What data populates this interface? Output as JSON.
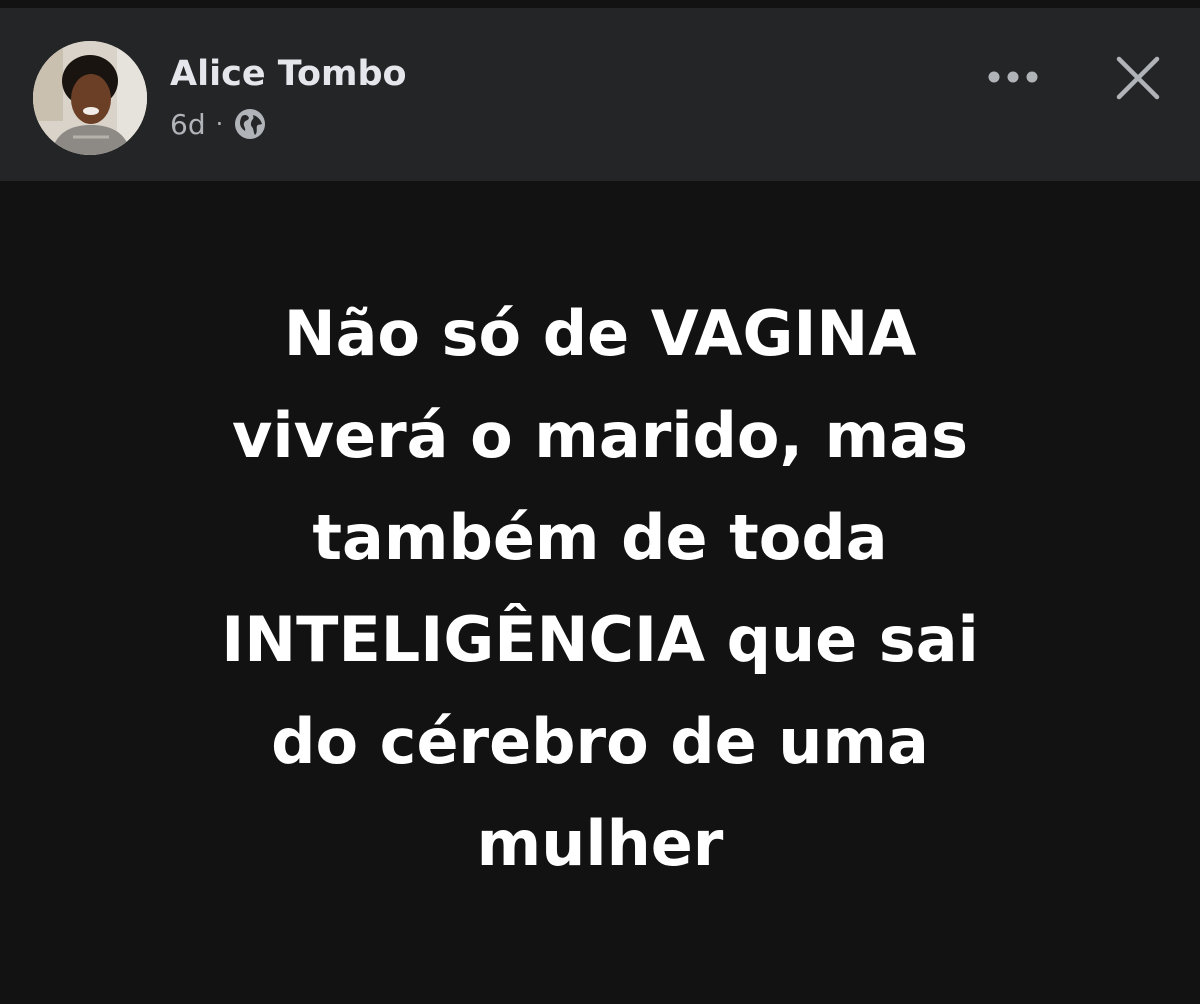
{
  "post": {
    "author": "Alice Tombo",
    "time": "6d",
    "separator": "·",
    "privacy_icon": "globe-icon",
    "more_icon": "more-horizontal-icon",
    "close_icon": "close-icon",
    "text": "Não só de VAGINA\nviverá o marido, mas\ntambém de toda\nINTELIGÊNCIA que sai\ndo cérebro de uma\nmulher"
  },
  "colors": {
    "header_background": "#242526",
    "post_background": "#121212",
    "name_text": "#e4e6eb",
    "meta_text": "#b0b3b8",
    "post_text": "#ffffff"
  }
}
